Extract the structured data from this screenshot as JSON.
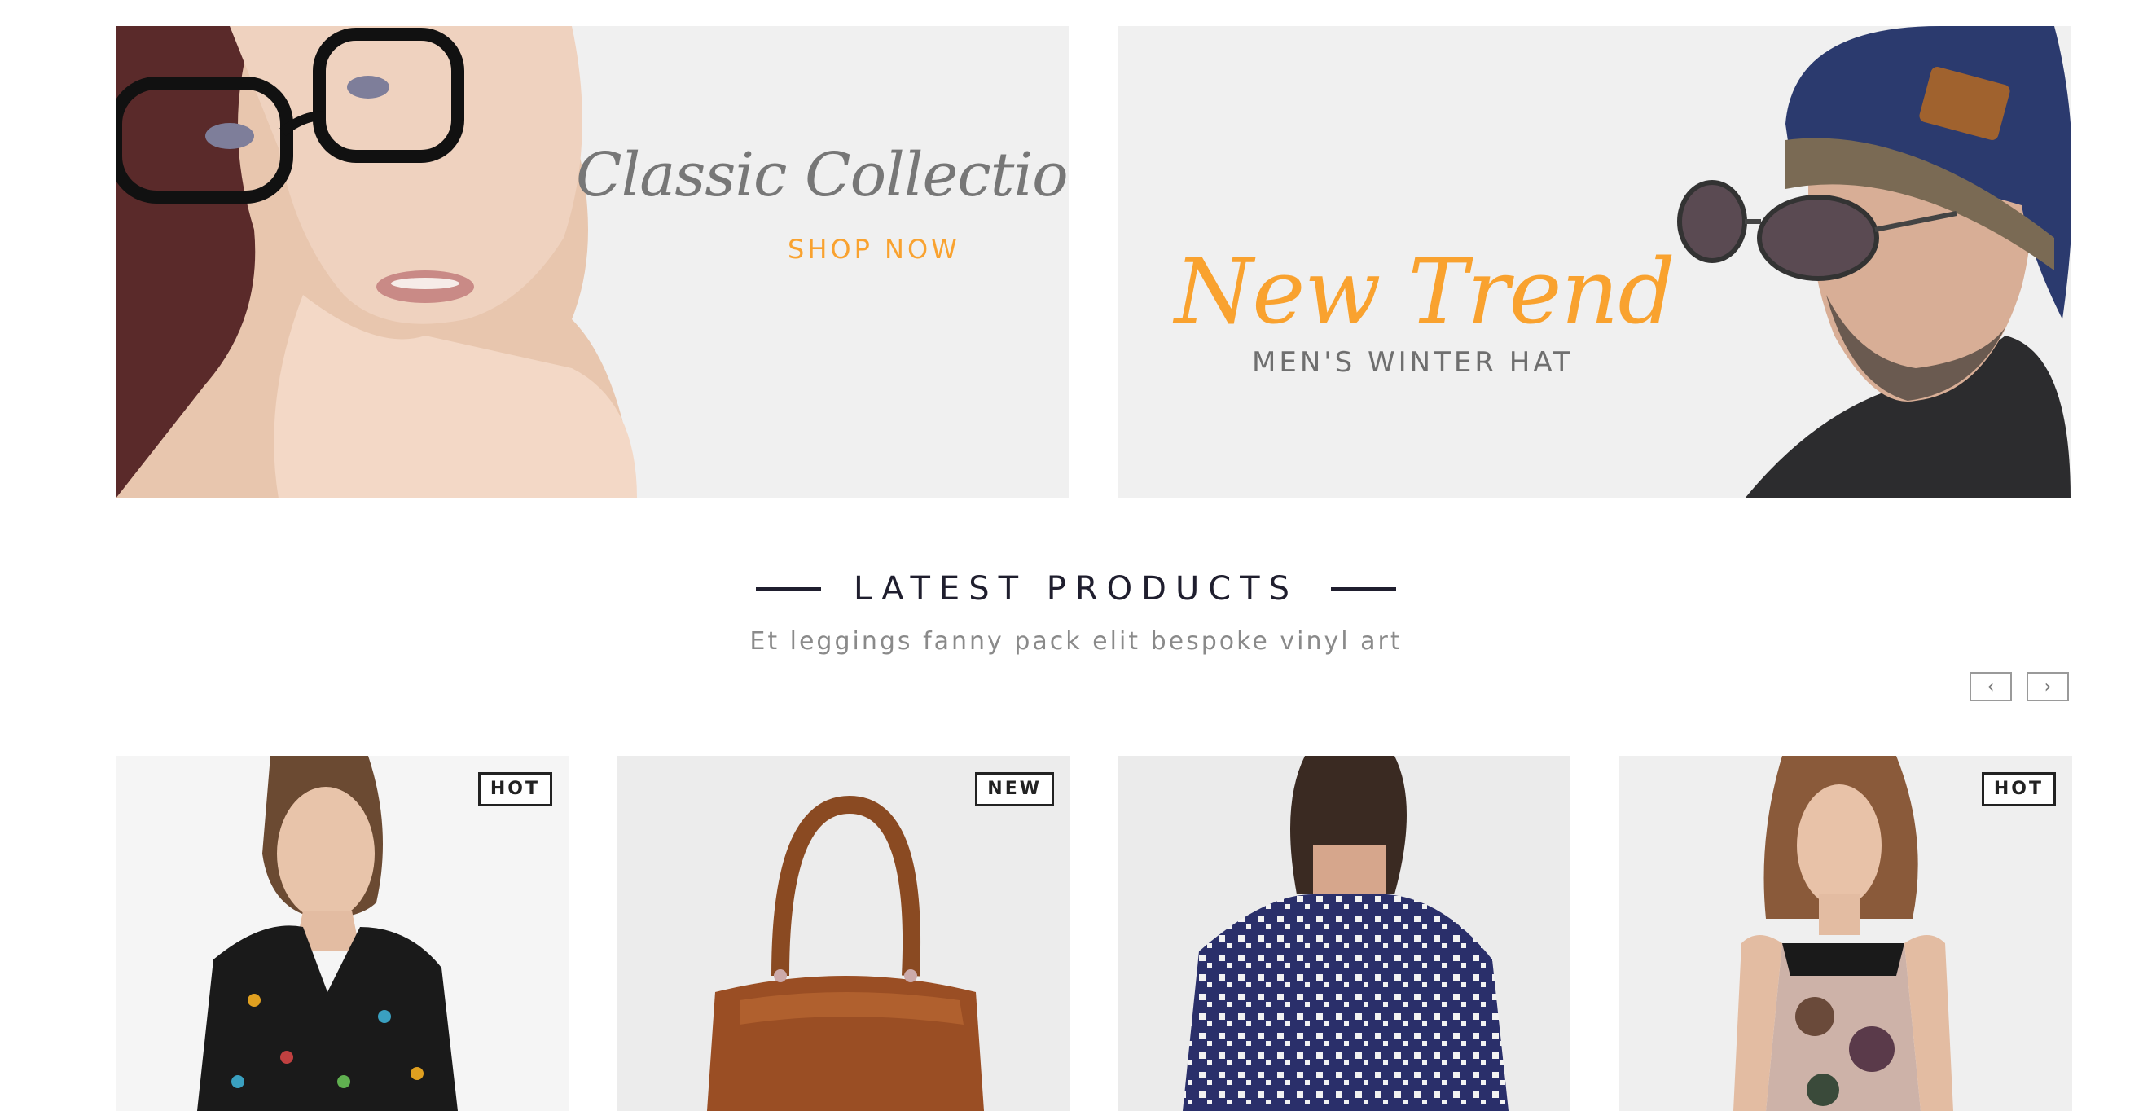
{
  "banners": {
    "left": {
      "title": "Classic Collection",
      "cta": "SHOP NOW"
    },
    "right": {
      "title": "New Trend",
      "subtitle": "MEN'S WINTER HAT"
    }
  },
  "section": {
    "title": "LATEST PRODUCTS",
    "subtitle": "Et leggings fanny pack elit bespoke vinyl art",
    "prev_icon": "chevron-left-icon",
    "next_icon": "chevron-right-icon"
  },
  "products": [
    {
      "badge": "HOT",
      "image": "woman-bird-print-blouse"
    },
    {
      "badge": "NEW",
      "image": "brown-leather-handbag"
    },
    {
      "badge": "",
      "image": "man-patterned-shirt-back"
    },
    {
      "badge": "HOT",
      "image": "woman-floral-dress"
    }
  ],
  "colors": {
    "accent": "#f9a22f",
    "heading": "#1f1e2e",
    "banner_bg": "#f0f0f0",
    "script_gray": "#777777"
  }
}
